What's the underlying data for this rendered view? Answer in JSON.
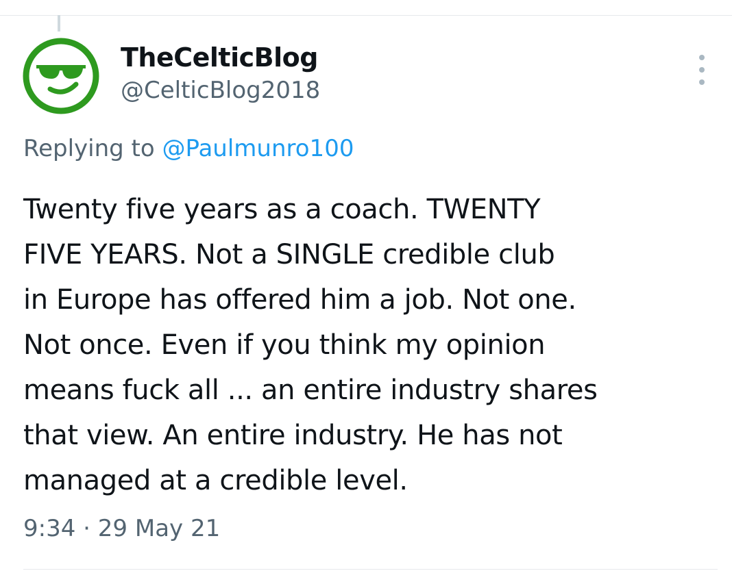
{
  "tweet": {
    "display_name": "TheCelticBlog",
    "handle": "@CelticBlog2018",
    "reply_prefix": "Replying to",
    "reply_to": "@Paulmunro100",
    "text_lines": [
      "Twenty five years as a coach. TWENTY",
      "FIVE YEARS. Not a SINGLE credible club",
      "in Europe has offered him a job. Not one.",
      "Not once. Even if you think my opinion",
      "means fuck all ... an entire industry shares",
      "that view. An entire industry. He has not",
      "managed at a credible level."
    ],
    "time": "9:34",
    "separator": "·",
    "date": "29 May 21"
  },
  "icons": {
    "avatar": "sunglasses-smiley-icon",
    "more": "more-vertical-icon"
  },
  "colors": {
    "text": "#0f1419",
    "secondary": "#536471",
    "link": "#1d9bf0",
    "avatar_green": "#2e9a1f"
  }
}
